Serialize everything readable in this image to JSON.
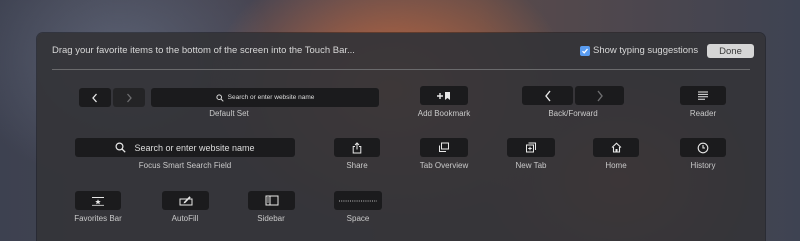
{
  "header": {
    "instruction": "Drag your favorite items to the bottom of the screen into the Touch Bar...",
    "show_typing_suggestions": {
      "label": "Show typing suggestions",
      "checked": true
    },
    "done_label": "Done"
  },
  "items": {
    "default_set": {
      "label": "Default Set",
      "search_text": "Search or enter website name"
    },
    "add_bookmark": {
      "label": "Add Bookmark"
    },
    "back_forward": {
      "label": "Back/Forward"
    },
    "reader": {
      "label": "Reader"
    },
    "focus_search": {
      "label": "Focus Smart Search Field",
      "search_text": "Search or enter website name"
    },
    "share": {
      "label": "Share"
    },
    "tab_overview": {
      "label": "Tab Overview"
    },
    "new_tab": {
      "label": "New Tab"
    },
    "home": {
      "label": "Home"
    },
    "history": {
      "label": "History"
    },
    "favorites_bar": {
      "label": "Favorites Bar"
    },
    "autofill": {
      "label": "AutoFill"
    },
    "sidebar": {
      "label": "Sidebar"
    },
    "space": {
      "label": "Space"
    }
  },
  "colors": {
    "accent": "#5a9cf0",
    "panel": "#343438",
    "key": "#1b1b1d"
  }
}
